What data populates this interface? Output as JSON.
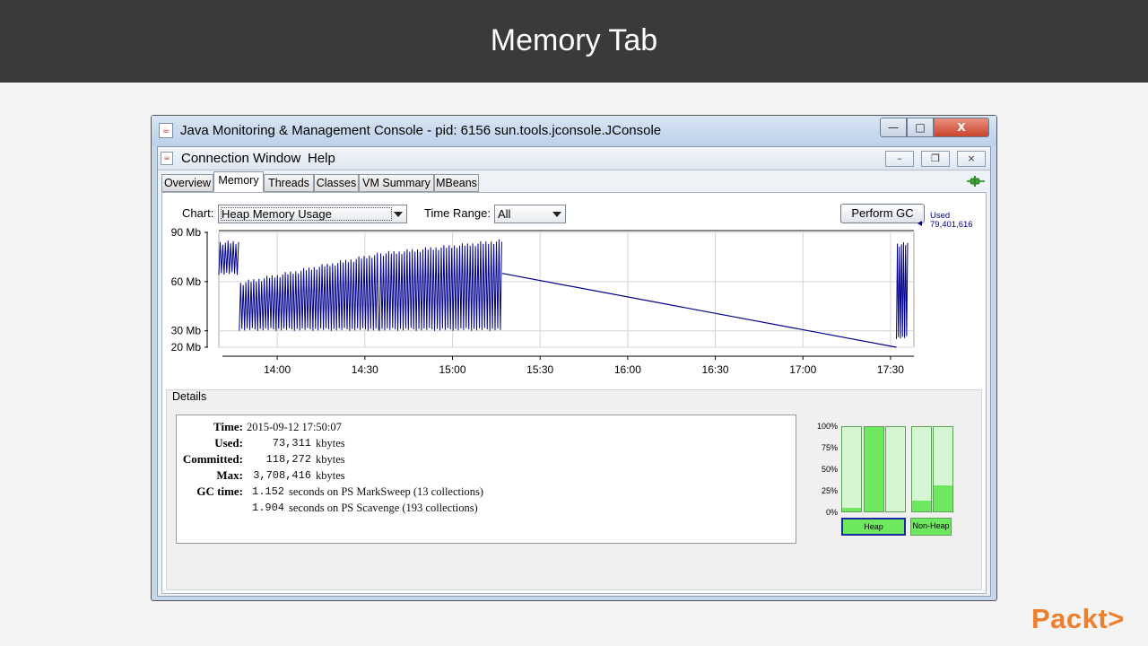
{
  "slide": {
    "title": "Memory Tab",
    "logo": "Packt>"
  },
  "window": {
    "title": "Java Monitoring & Management Console - pid: 6156 sun.tools.jconsole.JConsole",
    "buttons": {
      "minimize": "—",
      "maximize": "□",
      "close": "X"
    }
  },
  "menubar": {
    "items": [
      "Connection",
      "Window",
      "Help"
    ],
    "mdi_buttons": [
      "–",
      "❒",
      "×"
    ]
  },
  "tabs": [
    "Overview",
    "Memory",
    "Threads",
    "Classes",
    "VM Summary",
    "MBeans"
  ],
  "active_tab": "Memory",
  "controls": {
    "chart_label": "Chart:",
    "chart_value": "Heap Memory Usage",
    "time_range_label": "Time Range:",
    "time_range_value": "All",
    "perform_gc": "Perform GC"
  },
  "chart_data": {
    "type": "line",
    "y_ticks": [
      "90 Mb",
      "60 Mb",
      "30 Mb",
      "20 Mb"
    ],
    "y_tick_values": [
      90,
      60,
      30,
      20
    ],
    "x_ticks": [
      "14:00",
      "14:30",
      "15:00",
      "15:30",
      "16:00",
      "16:30",
      "17:00",
      "17:30"
    ],
    "ylim": [
      20,
      90
    ],
    "grid": true,
    "series": [
      {
        "name": "Used",
        "color": "#00008b",
        "last_value": "79,401,616",
        "segments": [
          {
            "from": "13:40",
            "to": "13:47",
            "min": 64,
            "max": 85
          },
          {
            "from": "13:47",
            "to": "14:35",
            "min": 30,
            "max": 60,
            "max_end": 78
          },
          {
            "from": "14:35",
            "to": "15:17",
            "min": 30,
            "max": 78,
            "max_end": 86
          }
        ],
        "trend_line": [
          [
            "15:17",
            65
          ],
          [
            "17:32",
            20
          ]
        ],
        "final_segment": {
          "from": "17:32",
          "to": "17:36",
          "min": 25,
          "max": 84
        }
      }
    ]
  },
  "details": {
    "title": "Details",
    "rows": [
      {
        "key": "Time:",
        "value": "2015-09-12 17:50:07"
      },
      {
        "key": "Used:",
        "value": "73,311",
        "unit": "kbytes"
      },
      {
        "key": "Committed:",
        "value": "118,272",
        "unit": "kbytes"
      },
      {
        "key": "Max:",
        "value": "3,708,416",
        "unit": "kbytes"
      },
      {
        "key": "GC time:",
        "value": "1.152",
        "unit": "seconds on PS MarkSweep (13 collections)"
      },
      {
        "key": "",
        "value": "1.904",
        "unit": "seconds on PS Scavenge (193 collections)"
      }
    ]
  },
  "memory_pools": {
    "pct_labels": [
      "100%",
      "75%",
      "50%",
      "25%",
      "0%"
    ],
    "heap_label": "Heap",
    "nonheap_label": "Non-Heap",
    "heap_fill": [
      0.04,
      1.0,
      0.0
    ],
    "nonheap_fill": [
      0.13,
      0.31
    ],
    "colors": {
      "fill": "#6ee85e",
      "empty": "#d6f5d2"
    }
  }
}
